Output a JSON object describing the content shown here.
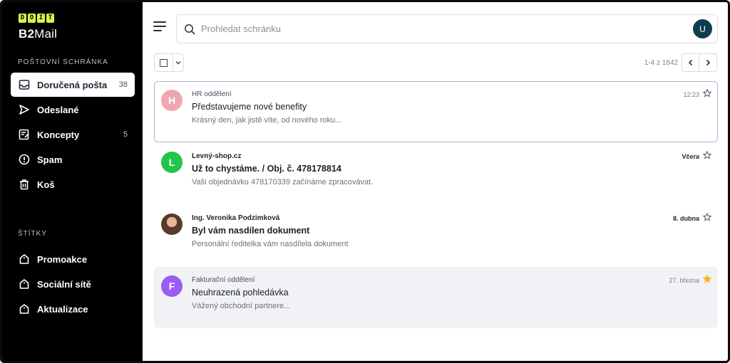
{
  "app": {
    "logo_letters": [
      "D",
      "O",
      "I",
      "T"
    ],
    "name_bold": "B2",
    "name_light": "Mail"
  },
  "sidebar": {
    "mailbox_title": "POŠTOVNÍ SCHRÁNKA",
    "items": [
      {
        "label": "Doručená pošta",
        "count": "38",
        "icon": "inbox-icon",
        "active": true
      },
      {
        "label": "Odeslané",
        "count": "",
        "icon": "send-icon"
      },
      {
        "label": "Koncepty",
        "count": "5",
        "icon": "draft-icon"
      },
      {
        "label": "Spam",
        "count": "",
        "icon": "spam-icon"
      },
      {
        "label": "Koš",
        "count": "",
        "icon": "trash-icon"
      }
    ],
    "labels_title": "ŠTÍTKY",
    "labels": [
      {
        "label": "Promoakce",
        "icon": "tag-icon"
      },
      {
        "label": "Sociální sítě",
        "icon": "tag-icon"
      },
      {
        "label": "Aktualizace",
        "icon": "tag-icon"
      }
    ]
  },
  "search": {
    "placeholder": "Prohledat schránku",
    "value": ""
  },
  "user": {
    "avatar_initial": "U"
  },
  "toolbar": {
    "pager_text": "1-4 z 1842"
  },
  "mails": [
    {
      "avatar": "H",
      "avatar_color": "#efa7ae",
      "sender": "HR oddělení",
      "subject": "Představujeme nové benefity",
      "preview": "Krásný den, jak jistě víte, od nového roku...",
      "time": "12:23",
      "starred": false,
      "unread": false,
      "selected": true
    },
    {
      "avatar": "L",
      "avatar_color": "#22c54a",
      "sender": "Levný-shop.cz",
      "subject": "Už to chystáme. / Obj. č. 478178814",
      "preview": "Vaši objednávku 478170339 začínáme zpracovávat.",
      "time": "Včera",
      "starred": false,
      "unread": true
    },
    {
      "avatar": "",
      "avatar_color": "#6b4a3a",
      "sender": "Ing. Veronika Podzimková",
      "subject": "Byl vám nasdílen dokument",
      "preview": "Personální ředitelka vám nasdílela dokument",
      "time": "8. dubna",
      "starred": false,
      "unread": true,
      "photo": true
    },
    {
      "avatar": "F",
      "avatar_color": "#9b5cf2",
      "sender": "Fakturační oddělení",
      "subject": "Neuhrazená pohledávka",
      "preview": "Vážený obchodní partnere...",
      "time": "27. března",
      "starred": true,
      "unread": false,
      "greyed": true
    }
  ],
  "colors": {
    "sidebar_bg": "#000000",
    "logo_accent": "#d8f24a",
    "star_active": "#f5b71b"
  }
}
